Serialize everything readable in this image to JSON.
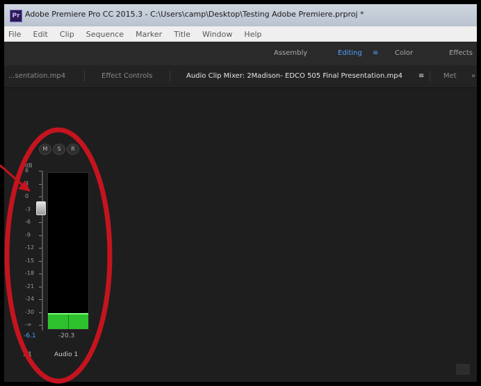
{
  "window": {
    "title": "Adobe Premiere Pro CC 2015.3 - C:\\Users\\camp\\Desktop\\Testing Adobe Premiere.prproj *",
    "icon": "Pr"
  },
  "menu": [
    "File",
    "Edit",
    "Clip",
    "Sequence",
    "Marker",
    "Title",
    "Window",
    "Help"
  ],
  "workspaces": {
    "assembly": "Assembly",
    "editing": "Editing",
    "editing_menu": "≡",
    "color": "Color",
    "effects": "Effects"
  },
  "panels": {
    "tab1": "...sentation.mp4",
    "tab2": "Effect Controls",
    "tab3": "Audio Clip Mixer: 2Madison- EDCO 505 Final Presentation.mp4",
    "tab3_menu": "≡",
    "tab4": "Met",
    "overflow": "»"
  },
  "mixer": {
    "buttons": {
      "mute": "M",
      "solo": "S",
      "record": "R"
    },
    "db_unit": "dB",
    "ticks": [
      "6",
      "3",
      "0",
      "-3",
      "-6",
      "-9",
      "-12",
      "-15",
      "-18",
      "-21",
      "-24",
      "-30",
      "-∞"
    ],
    "fader_value": "-6.1",
    "meter_value": "-20.3",
    "track_label": "A1",
    "track_name": "Audio 1",
    "meter_level": 0.1,
    "fader_level": 0.77
  },
  "colors": {
    "accent": "#4da2ff",
    "meter": "#2ec12e",
    "annotation": "#c4141f"
  }
}
